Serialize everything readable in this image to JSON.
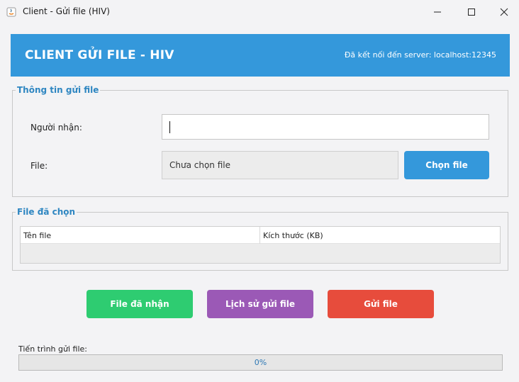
{
  "window": {
    "title": "Client - Gửi file (HIV)",
    "app_icon": "java-icon"
  },
  "header": {
    "title": "CLIENT GỬI FILE - HIV",
    "status": "Đã kết nối đến server: localhost:12345",
    "background_color": "#3498db"
  },
  "send_info": {
    "legend": "Thông tin gửi file",
    "recipient_label": "Người nhận:",
    "recipient_value": "",
    "file_label": "File:",
    "file_display": "Chưa chọn file",
    "choose_button": "Chọn file"
  },
  "selected_files": {
    "legend": "File đã chọn",
    "columns": [
      "Tên file",
      "Kích thước (KB)"
    ],
    "rows": []
  },
  "actions": {
    "received_button": "File đã nhận",
    "history_button": "Lịch sử gửi file",
    "send_button": "Gửi file",
    "colors": {
      "received": "#2ecc71",
      "history": "#9b59b6",
      "send": "#e74c3c"
    }
  },
  "progress": {
    "label": "Tiến trình gửi file:",
    "value_percent": 0,
    "text": "0%"
  }
}
